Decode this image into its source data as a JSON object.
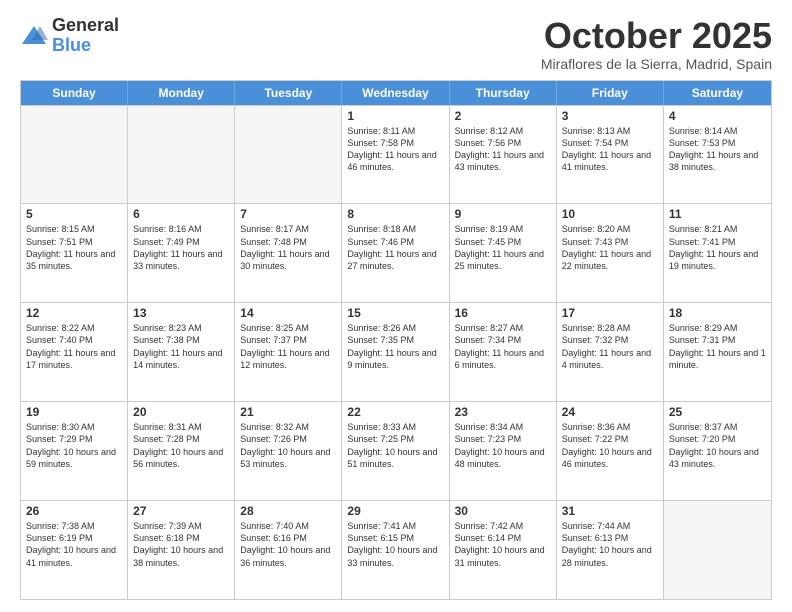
{
  "logo": {
    "general": "General",
    "blue": "Blue"
  },
  "header": {
    "month": "October 2025",
    "location": "Miraflores de la Sierra, Madrid, Spain"
  },
  "days": [
    "Sunday",
    "Monday",
    "Tuesday",
    "Wednesday",
    "Thursday",
    "Friday",
    "Saturday"
  ],
  "weeks": [
    [
      {
        "day": "",
        "empty": true
      },
      {
        "day": "",
        "empty": true
      },
      {
        "day": "",
        "empty": true
      },
      {
        "day": "1",
        "sunrise": "Sunrise: 8:11 AM",
        "sunset": "Sunset: 7:58 PM",
        "daylight": "Daylight: 11 hours and 46 minutes."
      },
      {
        "day": "2",
        "sunrise": "Sunrise: 8:12 AM",
        "sunset": "Sunset: 7:56 PM",
        "daylight": "Daylight: 11 hours and 43 minutes."
      },
      {
        "day": "3",
        "sunrise": "Sunrise: 8:13 AM",
        "sunset": "Sunset: 7:54 PM",
        "daylight": "Daylight: 11 hours and 41 minutes."
      },
      {
        "day": "4",
        "sunrise": "Sunrise: 8:14 AM",
        "sunset": "Sunset: 7:53 PM",
        "daylight": "Daylight: 11 hours and 38 minutes."
      }
    ],
    [
      {
        "day": "5",
        "sunrise": "Sunrise: 8:15 AM",
        "sunset": "Sunset: 7:51 PM",
        "daylight": "Daylight: 11 hours and 35 minutes."
      },
      {
        "day": "6",
        "sunrise": "Sunrise: 8:16 AM",
        "sunset": "Sunset: 7:49 PM",
        "daylight": "Daylight: 11 hours and 33 minutes."
      },
      {
        "day": "7",
        "sunrise": "Sunrise: 8:17 AM",
        "sunset": "Sunset: 7:48 PM",
        "daylight": "Daylight: 11 hours and 30 minutes."
      },
      {
        "day": "8",
        "sunrise": "Sunrise: 8:18 AM",
        "sunset": "Sunset: 7:46 PM",
        "daylight": "Daylight: 11 hours and 27 minutes."
      },
      {
        "day": "9",
        "sunrise": "Sunrise: 8:19 AM",
        "sunset": "Sunset: 7:45 PM",
        "daylight": "Daylight: 11 hours and 25 minutes."
      },
      {
        "day": "10",
        "sunrise": "Sunrise: 8:20 AM",
        "sunset": "Sunset: 7:43 PM",
        "daylight": "Daylight: 11 hours and 22 minutes."
      },
      {
        "day": "11",
        "sunrise": "Sunrise: 8:21 AM",
        "sunset": "Sunset: 7:41 PM",
        "daylight": "Daylight: 11 hours and 19 minutes."
      }
    ],
    [
      {
        "day": "12",
        "sunrise": "Sunrise: 8:22 AM",
        "sunset": "Sunset: 7:40 PM",
        "daylight": "Daylight: 11 hours and 17 minutes."
      },
      {
        "day": "13",
        "sunrise": "Sunrise: 8:23 AM",
        "sunset": "Sunset: 7:38 PM",
        "daylight": "Daylight: 11 hours and 14 minutes."
      },
      {
        "day": "14",
        "sunrise": "Sunrise: 8:25 AM",
        "sunset": "Sunset: 7:37 PM",
        "daylight": "Daylight: 11 hours and 12 minutes."
      },
      {
        "day": "15",
        "sunrise": "Sunrise: 8:26 AM",
        "sunset": "Sunset: 7:35 PM",
        "daylight": "Daylight: 11 hours and 9 minutes."
      },
      {
        "day": "16",
        "sunrise": "Sunrise: 8:27 AM",
        "sunset": "Sunset: 7:34 PM",
        "daylight": "Daylight: 11 hours and 6 minutes."
      },
      {
        "day": "17",
        "sunrise": "Sunrise: 8:28 AM",
        "sunset": "Sunset: 7:32 PM",
        "daylight": "Daylight: 11 hours and 4 minutes."
      },
      {
        "day": "18",
        "sunrise": "Sunrise: 8:29 AM",
        "sunset": "Sunset: 7:31 PM",
        "daylight": "Daylight: 11 hours and 1 minute."
      }
    ],
    [
      {
        "day": "19",
        "sunrise": "Sunrise: 8:30 AM",
        "sunset": "Sunset: 7:29 PM",
        "daylight": "Daylight: 10 hours and 59 minutes."
      },
      {
        "day": "20",
        "sunrise": "Sunrise: 8:31 AM",
        "sunset": "Sunset: 7:28 PM",
        "daylight": "Daylight: 10 hours and 56 minutes."
      },
      {
        "day": "21",
        "sunrise": "Sunrise: 8:32 AM",
        "sunset": "Sunset: 7:26 PM",
        "daylight": "Daylight: 10 hours and 53 minutes."
      },
      {
        "day": "22",
        "sunrise": "Sunrise: 8:33 AM",
        "sunset": "Sunset: 7:25 PM",
        "daylight": "Daylight: 10 hours and 51 minutes."
      },
      {
        "day": "23",
        "sunrise": "Sunrise: 8:34 AM",
        "sunset": "Sunset: 7:23 PM",
        "daylight": "Daylight: 10 hours and 48 minutes."
      },
      {
        "day": "24",
        "sunrise": "Sunrise: 8:36 AM",
        "sunset": "Sunset: 7:22 PM",
        "daylight": "Daylight: 10 hours and 46 minutes."
      },
      {
        "day": "25",
        "sunrise": "Sunrise: 8:37 AM",
        "sunset": "Sunset: 7:20 PM",
        "daylight": "Daylight: 10 hours and 43 minutes."
      }
    ],
    [
      {
        "day": "26",
        "sunrise": "Sunrise: 7:38 AM",
        "sunset": "Sunset: 6:19 PM",
        "daylight": "Daylight: 10 hours and 41 minutes."
      },
      {
        "day": "27",
        "sunrise": "Sunrise: 7:39 AM",
        "sunset": "Sunset: 6:18 PM",
        "daylight": "Daylight: 10 hours and 38 minutes."
      },
      {
        "day": "28",
        "sunrise": "Sunrise: 7:40 AM",
        "sunset": "Sunset: 6:16 PM",
        "daylight": "Daylight: 10 hours and 36 minutes."
      },
      {
        "day": "29",
        "sunrise": "Sunrise: 7:41 AM",
        "sunset": "Sunset: 6:15 PM",
        "daylight": "Daylight: 10 hours and 33 minutes."
      },
      {
        "day": "30",
        "sunrise": "Sunrise: 7:42 AM",
        "sunset": "Sunset: 6:14 PM",
        "daylight": "Daylight: 10 hours and 31 minutes."
      },
      {
        "day": "31",
        "sunrise": "Sunrise: 7:44 AM",
        "sunset": "Sunset: 6:13 PM",
        "daylight": "Daylight: 10 hours and 28 minutes."
      },
      {
        "day": "",
        "empty": true
      }
    ]
  ]
}
